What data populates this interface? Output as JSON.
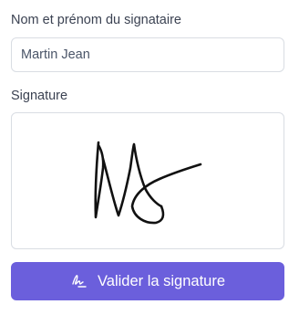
{
  "form": {
    "name_label": "Nom et prénom du signataire",
    "name_value": "Martin Jean",
    "signature_label": "Signature",
    "signature_pad": {
      "icon": "signature-drawing",
      "has_signature": true,
      "stroke_color": "#111111"
    },
    "submit": {
      "label": "Valider la signature",
      "icon": "signature-icon"
    }
  },
  "colors": {
    "accent": "#6b5fdc",
    "border": "#d9dde3",
    "label_text": "#3b4252"
  }
}
